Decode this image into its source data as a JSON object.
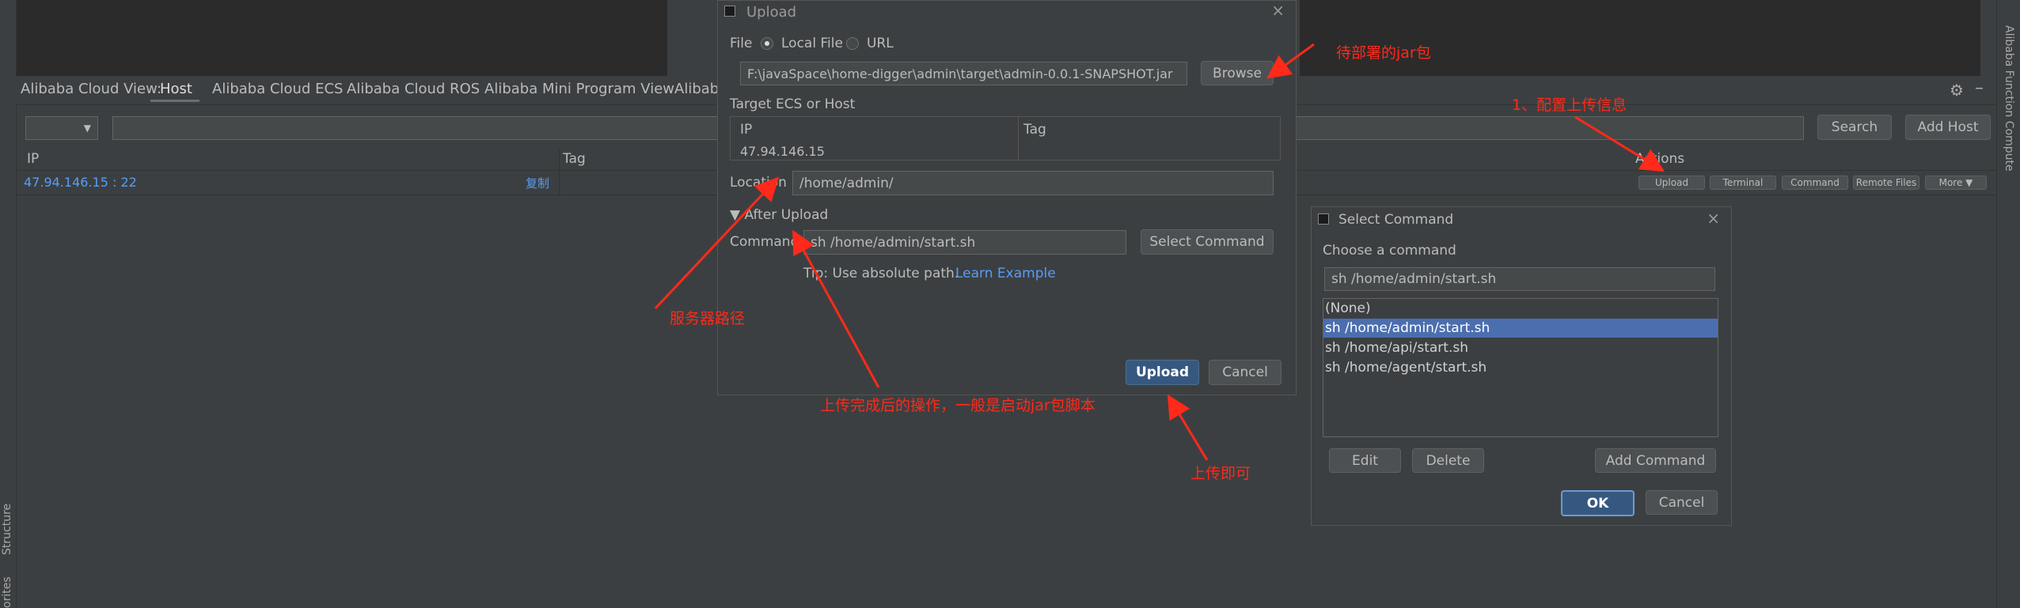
{
  "app": {
    "view_label": "Alibaba Cloud View:",
    "tabs": [
      "Host",
      "Alibaba Cloud ECS",
      "Alibaba Cloud ROS",
      "Alibaba Mini Program View",
      "Alibaba"
    ],
    "search_button": "Search",
    "add_host_button": "Add Host",
    "columns": {
      "ip": "IP",
      "tag": "Tag",
      "actions": "Actions"
    },
    "row": {
      "ip": "47.94.146.15 : 22",
      "copy": "复制",
      "actions": [
        "Upload",
        "Terminal",
        "Command",
        "Remote Files",
        "More ▼"
      ]
    },
    "right_sidebar_label": "Alibaba Function Compute",
    "left_sidebar_labels": [
      "Structure",
      "orites"
    ]
  },
  "upload_dialog": {
    "title": "Upload",
    "file_label": "File",
    "local_file": "Local File",
    "url": "URL",
    "file_path": "F:\\javaSpace\\home-digger\\admin\\target\\admin-0.0.1-SNAPSHOT.jar",
    "browse": "Browse",
    "target_label": "Target ECS or Host",
    "target_columns": [
      "IP",
      "Tag"
    ],
    "target_ip": "47.94.146.15",
    "location_label": "Location",
    "location_value": "/home/admin/",
    "after_upload": "▼ After Upload",
    "command_label": "Command",
    "command_value": "sh /home/admin/start.sh",
    "select_command": "Select Command",
    "tip": "Tip: Use absolute path.",
    "learn_example": "Learn Example",
    "upload_button": "Upload",
    "cancel_button": "Cancel"
  },
  "select_dialog": {
    "title": "Select Command",
    "choose_label": "Choose a command",
    "input_value": "sh /home/admin/start.sh",
    "items": [
      "(None)",
      "sh /home/admin/start.sh",
      "sh /home/api/start.sh",
      "sh /home/agent/start.sh"
    ],
    "edit": "Edit",
    "delete": "Delete",
    "add_command": "Add Command",
    "ok": "OK",
    "cancel": "Cancel"
  },
  "annotations": {
    "jar": "待部署的jar包",
    "config": "1、配置上传信息",
    "server_path": "服务器路径",
    "after_ops": "上传完成后的操作，一般是启动jar包脚本",
    "upload": "上传即可"
  },
  "colors": {
    "background": "#3c3f41",
    "accent": "#4b6eaf",
    "annotation": "#ff2a1a",
    "link": "#589df6"
  }
}
